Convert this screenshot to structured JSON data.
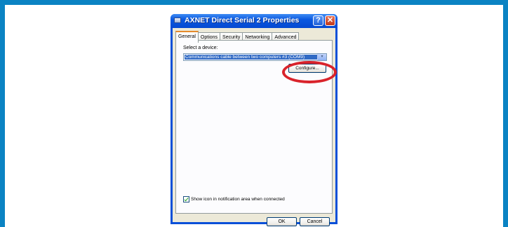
{
  "window": {
    "title": "AXNET Direct Serial 2 Properties",
    "help_label": "?",
    "close_label": "✕"
  },
  "tabs": [
    {
      "label": "General",
      "active": true
    },
    {
      "label": "Options"
    },
    {
      "label": "Security"
    },
    {
      "label": "Networking"
    },
    {
      "label": "Advanced"
    }
  ],
  "general": {
    "select_label": "Select a device:",
    "device_value": "Communications cable between two computers #3 (COM9)",
    "dropdown_arrow": "▾",
    "configure_label": "Configure...",
    "show_icon_label": "Show icon in notification area when connected",
    "show_icon_checked": true
  },
  "footer": {
    "ok_label": "OK",
    "cancel_label": "Cancel"
  },
  "colors": {
    "frame": "#0b83c3",
    "highlight": "#d9232b",
    "titlebar": "#0a58e0"
  }
}
